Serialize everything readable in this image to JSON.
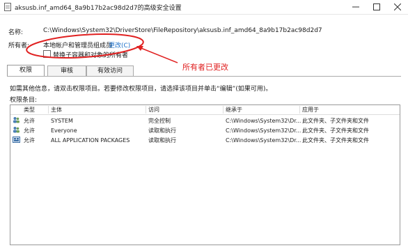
{
  "window": {
    "title": "aksusb.inf_amd64_8a9b17b2ac98d2d7的高级安全设置"
  },
  "header": {
    "name_label": "名称:",
    "name_value": "C:\\Windows\\System32\\DriverStore\\FileRepository\\aksusb.inf_amd64_8a9b17b2ac98d2d7",
    "owner_label": "所有者:",
    "owner_value": "本地帐户和管理员组成员",
    "change_link": "更改(C)",
    "replace_owner_checkbox": "替换子容器和对象的所有者"
  },
  "tabs": [
    {
      "label": "权限",
      "active": true
    },
    {
      "label": "审核",
      "active": false
    },
    {
      "label": "有效访问",
      "active": false
    }
  ],
  "info_text": "如需其他信息，请双击权限项目。若要修改权限项目，请选择该项目并单击“编辑”(如果可用)。",
  "entries_label": "权限条目:",
  "table": {
    "columns": [
      "类型",
      "主体",
      "访问",
      "继承于",
      "应用于"
    ],
    "rows": [
      {
        "icon": "user-group-icon",
        "type": "允许",
        "principal": "SYSTEM",
        "access": "完全控制",
        "inherited": "C:\\Windows\\System32\\Dr...",
        "applies": "此文件夹、子文件夹和文件"
      },
      {
        "icon": "user-group-icon",
        "type": "允许",
        "principal": "Everyone",
        "access": "读取和执行",
        "inherited": "C:\\Windows\\System32\\Dr...",
        "applies": "此文件夹、子文件夹和文件"
      },
      {
        "icon": "app-package-icon",
        "type": "允许",
        "principal": "ALL APPLICATION PACKAGES",
        "access": "读取和执行",
        "inherited": "C:\\Windows\\System32\\Dr...",
        "applies": "此文件夹、子文件夹和文件"
      }
    ]
  },
  "annotation": {
    "text": "所有者已更改",
    "color": "#e02020"
  }
}
